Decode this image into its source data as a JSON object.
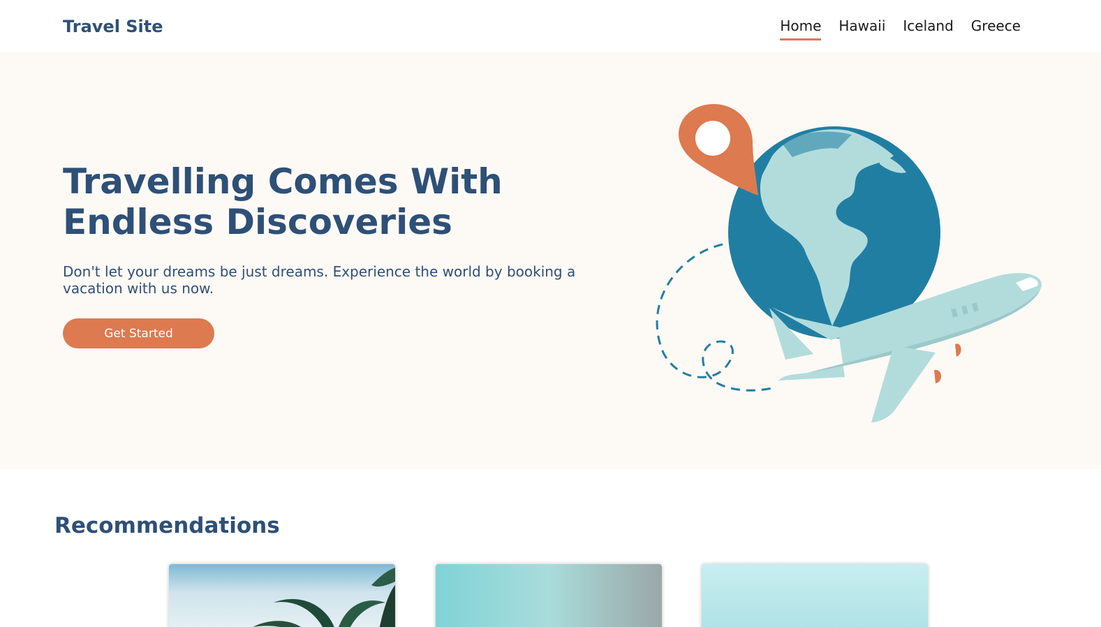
{
  "header": {
    "logo": "Travel Site",
    "nav": [
      {
        "label": "Home",
        "active": true
      },
      {
        "label": "Hawaii",
        "active": false
      },
      {
        "label": "Iceland",
        "active": false
      },
      {
        "label": "Greece",
        "active": false
      }
    ]
  },
  "hero": {
    "title_line1": "Travelling Comes With",
    "title_line2": "Endless Discoveries",
    "subtitle": "Don't let your dreams be just dreams. Experience the world by booking a vacation with us now.",
    "cta_label": "Get Started",
    "illustration_icons": [
      "location-pin-icon",
      "globe-icon",
      "airplane-icon",
      "dashed-flight-path"
    ]
  },
  "recommendations": {
    "title": "Recommendations",
    "cards": [
      {
        "image": "palm-trees-photo"
      },
      {
        "image": "turquoise-sea-photo"
      },
      {
        "image": "light-blue-sky-photo"
      }
    ]
  },
  "colors": {
    "brand": "#2e5077",
    "accent": "#dd7a4f",
    "hero_bg": "#fdf9f5",
    "globe": "#217ea3",
    "land": "#b2dcdc"
  }
}
